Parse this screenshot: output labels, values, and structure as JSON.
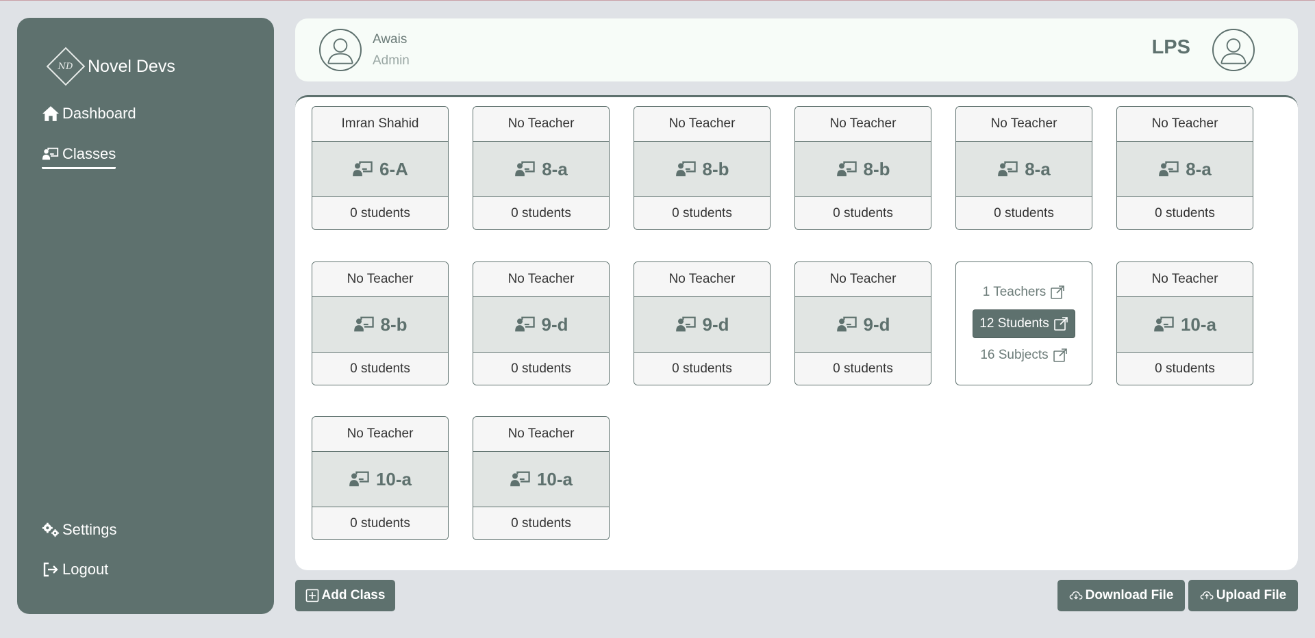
{
  "sidebar": {
    "brand": {
      "logo_text": "ND",
      "name": "Novel Devs"
    },
    "nav": [
      {
        "label": "Dashboard",
        "icon": "home-icon",
        "active": false
      },
      {
        "label": "Classes",
        "icon": "classroom-icon",
        "active": true
      }
    ],
    "bottom": [
      {
        "label": "Settings",
        "icon": "gears-icon"
      },
      {
        "label": "Logout",
        "icon": "logout-icon"
      }
    ]
  },
  "header": {
    "user_name": "Awais",
    "user_role": "Admin",
    "school": "LPS"
  },
  "classes": [
    {
      "teacher": "Imran Shahid",
      "name": "6-A",
      "students": "0 students"
    },
    {
      "teacher": "No Teacher",
      "name": "8-a",
      "students": "0 students"
    },
    {
      "teacher": "No Teacher",
      "name": "8-b",
      "students": "0 students"
    },
    {
      "teacher": "No Teacher",
      "name": "8-b",
      "students": "0 students"
    },
    {
      "teacher": "No Teacher",
      "name": "8-a",
      "students": "0 students"
    },
    {
      "teacher": "No Teacher",
      "name": "8-a",
      "students": "0 students"
    },
    {
      "teacher": "No Teacher",
      "name": "8-b",
      "students": "0 students"
    },
    {
      "teacher": "No Teacher",
      "name": "9-d",
      "students": "0 students"
    },
    {
      "teacher": "No Teacher",
      "name": "9-d",
      "students": "0 students"
    },
    {
      "teacher": "No Teacher",
      "name": "9-d",
      "students": "0 students"
    },
    {
      "hover": true,
      "teachers": "1 Teachers",
      "students_link": "12 Students",
      "subjects": "16 Subjects"
    },
    {
      "teacher": "No Teacher",
      "name": "10-a",
      "students": "0 students"
    },
    {
      "teacher": "No Teacher",
      "name": "10-a",
      "students": "0 students"
    },
    {
      "teacher": "No Teacher",
      "name": "10-a",
      "students": "0 students"
    }
  ],
  "actions": {
    "add_class": "Add Class",
    "download": "Download File",
    "upload": "Upload File"
  },
  "colors": {
    "primary": "#5e716e",
    "background": "#dfe2e6",
    "header_bg": "#f7fcf8"
  }
}
